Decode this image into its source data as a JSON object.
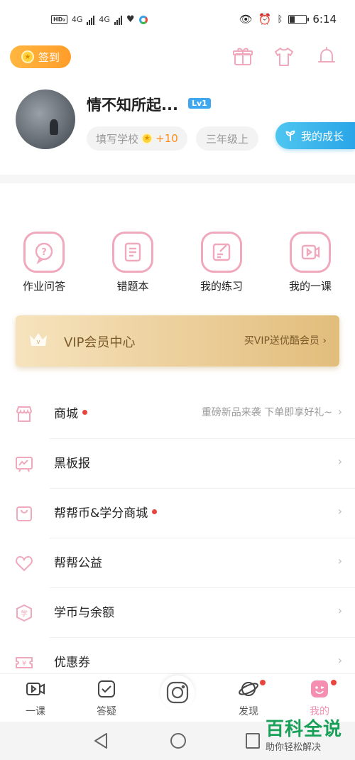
{
  "status_bar": {
    "left_text": [
      "HD₂",
      "4G",
      "4G"
    ],
    "time": "6:14",
    "battery_level": 0.35,
    "icons": [
      "eye-icon",
      "alarm-icon",
      "bluetooth-icon",
      "battery-icon"
    ]
  },
  "header": {
    "checkin_label": "签到",
    "top_icons": [
      "gift-icon",
      "tshirt-icon",
      "bell-icon"
    ],
    "username": "情不知所起...",
    "level": "Lv1",
    "school_chip": "填写学校",
    "school_bonus": "+10",
    "grade_chip": "三年级上",
    "growth_label": "我的成长"
  },
  "shortcuts": [
    {
      "label": "作业问答",
      "icon": "question-bubble-icon"
    },
    {
      "label": "错题本",
      "icon": "notebook-icon"
    },
    {
      "label": "我的练习",
      "icon": "edit-note-icon"
    },
    {
      "label": "我的一课",
      "icon": "video-play-icon"
    }
  ],
  "vip": {
    "title": "VIP会员中心",
    "link": "买VIP送优酷会员"
  },
  "menu": [
    {
      "label": "商城",
      "icon": "store-icon",
      "dot": true,
      "note": "重磅新品来袭 下单即享好礼~"
    },
    {
      "label": "黑板报",
      "icon": "blackboard-icon",
      "dot": false,
      "note": ""
    },
    {
      "label": "帮帮币&学分商城",
      "icon": "bag-icon",
      "dot": true,
      "note": ""
    },
    {
      "label": "帮帮公益",
      "icon": "heart-icon",
      "dot": false,
      "note": ""
    },
    {
      "label": "学币与余额",
      "icon": "coin-shield-icon",
      "dot": false,
      "note": "",
      "icon_text": "学"
    },
    {
      "label": "优惠券",
      "icon": "coupon-icon",
      "dot": false,
      "note": "",
      "icon_text": "¥"
    }
  ],
  "tabbar": [
    {
      "label": "一课",
      "icon": "video-icon",
      "dot": false,
      "active": false
    },
    {
      "label": "答疑",
      "icon": "check-box-icon",
      "dot": false,
      "active": false
    },
    {
      "label": "",
      "icon": "camera-icon",
      "dot": false,
      "active": false
    },
    {
      "label": "发现",
      "icon": "planet-icon",
      "dot": true,
      "active": false
    },
    {
      "label": "我的",
      "icon": "face-icon",
      "dot": true,
      "active": true
    }
  ],
  "watermark": {
    "title": "百科全说",
    "subtitle": "助你轻松解决"
  },
  "colors": {
    "accent_pink": "#f0a8bc",
    "orange": "#ff9d2a",
    "blue": "#2aa5e8",
    "gold": "#e2bd7c",
    "red_dot": "#e9453f",
    "watermark_green": "#18a058"
  }
}
